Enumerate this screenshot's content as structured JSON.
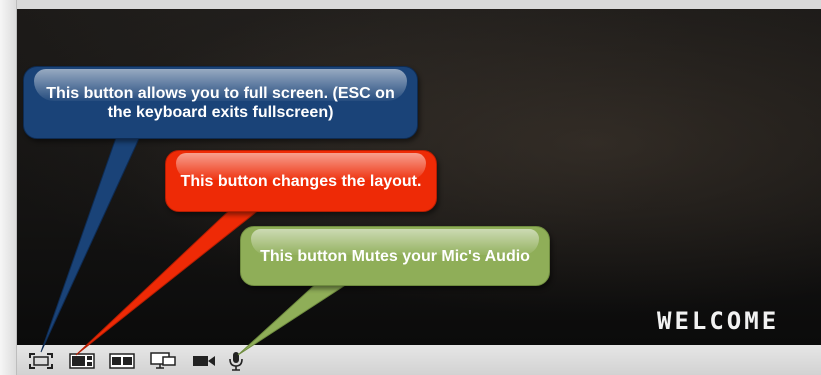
{
  "video": {
    "overlay_text": "WELCOME"
  },
  "toolbar": {
    "buttons": [
      {
        "name": "fullscreen-button",
        "icon": "fullscreen-icon"
      },
      {
        "name": "layout-button-1",
        "icon": "layout-presenter-icon"
      },
      {
        "name": "layout-button-2",
        "icon": "layout-side-by-side-icon"
      },
      {
        "name": "screen-share-button",
        "icon": "monitor-icon"
      },
      {
        "name": "camera-button",
        "icon": "video-camera-icon"
      },
      {
        "name": "mic-button",
        "icon": "microphone-icon"
      }
    ]
  },
  "callouts": {
    "fullscreen": {
      "text": "This button allows you to full screen. (ESC on the keyboard exits fullscreen)",
      "color": "#1a4378"
    },
    "layout": {
      "text": "This button changes the layout.",
      "color": "#ee2a06"
    },
    "mute": {
      "text": "This button Mutes your Mic's Audio",
      "color": "#8fae58"
    }
  }
}
